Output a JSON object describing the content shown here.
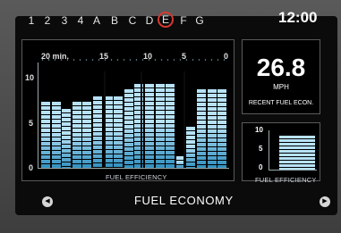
{
  "header": {
    "mode_keys": [
      "1",
      "2",
      "3",
      "4",
      "A",
      "B",
      "C",
      "D",
      "E",
      "F",
      "G"
    ],
    "active_key": "E",
    "clock": "12:00"
  },
  "main_chart": {
    "x_ticks": [
      "20 min.",
      "15",
      "10",
      "5",
      "0"
    ],
    "y_ticks": [
      "10",
      "5",
      "0"
    ],
    "caption": "FUEL EFFICIENCY"
  },
  "chart_data": {
    "type": "bar",
    "title": "",
    "xlabel": "FUEL EFFICIENCY",
    "ylabel": "",
    "x_ticks": [
      "20 min.",
      "15",
      "10",
      "5",
      "0"
    ],
    "ylim": [
      0,
      10
    ],
    "values": [
      7.4,
      7.4,
      6.6,
      7.4,
      7.4,
      8.0,
      8.0,
      8.0,
      8.8,
      9.4,
      9.4,
      9.4,
      9.4,
      1.3,
      4.6,
      8.8,
      8.8,
      8.8
    ],
    "bar_color": "#b7e2f7",
    "grid": false
  },
  "recent": {
    "value": "26.8",
    "unit": "MPH",
    "label": "RECENT FUEL ECON."
  },
  "small_chart": {
    "y_ticks": [
      "10",
      "5",
      "0"
    ],
    "value": 8.6,
    "caption": "FUEL EFFICIENCY"
  },
  "footer": {
    "title": "FUEL ECONOMY",
    "left_icon": "left-arrow-icon",
    "right_icon": "right-arrow-icon"
  },
  "colors": {
    "accent_ring": "#d43a32",
    "bar": "#b7e2f7",
    "screen_bg": "#0b0b0b"
  }
}
